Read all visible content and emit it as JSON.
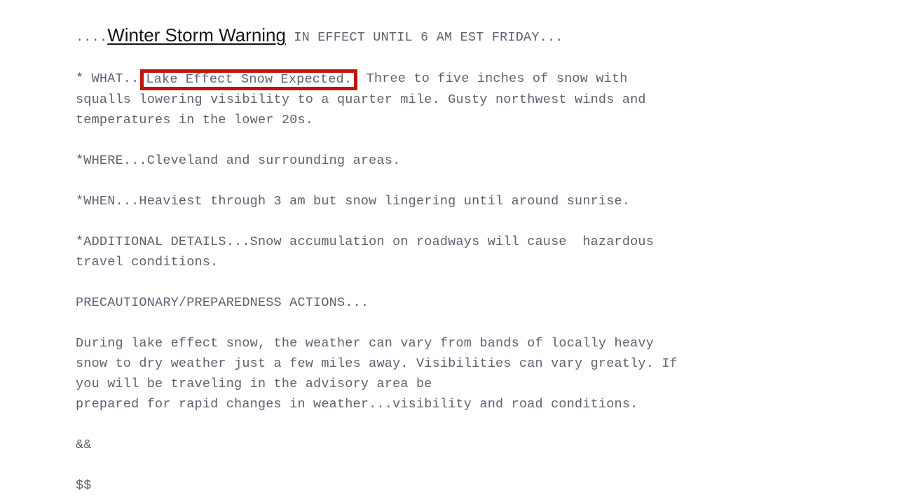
{
  "document": {
    "type": "nws-weather-alert-text",
    "background_color": "#ffffff",
    "body_text_color": "#5b6270",
    "highlight_color": "#be1512",
    "title_color": "#141414",
    "headline": {
      "leading_dots": "....",
      "event_title": "Winter Storm Warning",
      "tail": " IN EFFECT UNTIL 6 AM EST FRIDAY..."
    },
    "what": {
      "label": "* WHAT..",
      "highlighted_phrase": "Lake Effect Snow Expected.",
      "line1_tail": " Three to five inches of snow with",
      "line2": "squalls lowering visibility to a quarter mile. Gusty northwest winds and",
      "line3": "temperatures in the lower 20s."
    },
    "where": "*WHERE...Cleveland and surrounding areas.",
    "when": "*WHEN...Heaviest through 3 am but snow lingering until around sunrise.",
    "additional_details": {
      "line1": "*ADDITIONAL DETAILS...Snow accumulation on roadways will cause  hazardous",
      "line2": "travel conditions."
    },
    "precautionary_heading": "PRECAUTIONARY/PREPAREDNESS ACTIONS...",
    "precautionary_body": {
      "line1": "During lake effect snow, the weather can vary from bands of locally heavy",
      "line2": "snow to dry weather just a few miles away. Visibilities can vary greatly. If",
      "line3": "you will be traveling in the advisory area be",
      "line4": "prepared for rapid changes in weather...visibility and road conditions."
    },
    "segment_separator": "&&",
    "end_marker": "$$"
  }
}
